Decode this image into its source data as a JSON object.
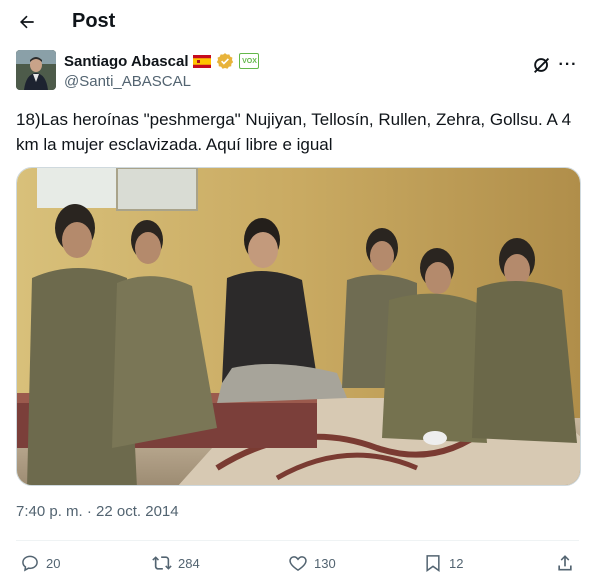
{
  "header": {
    "title": "Post",
    "back_icon": "arrow-left-icon"
  },
  "author": {
    "name": "Santiago Abascal",
    "handle": "@Santi_ABASCAL",
    "badge_party": "VOX",
    "verified_color": "#e8b33a"
  },
  "tweet": {
    "text": "18)Las heroínas \"peshmerga\" Nujiyan, Tellosín, Rullen, Zehra, Gollsu. A 4 km la mujer esclavizada. Aquí libre e igual",
    "timestamp": "7:40 p. m. · 22 oct. 2014"
  },
  "actions": {
    "replies": "20",
    "reposts": "284",
    "likes": "130",
    "bookmarks": "12"
  },
  "colors": {
    "muted": "#536471",
    "text": "#0f1419",
    "border": "#cfd9de"
  }
}
